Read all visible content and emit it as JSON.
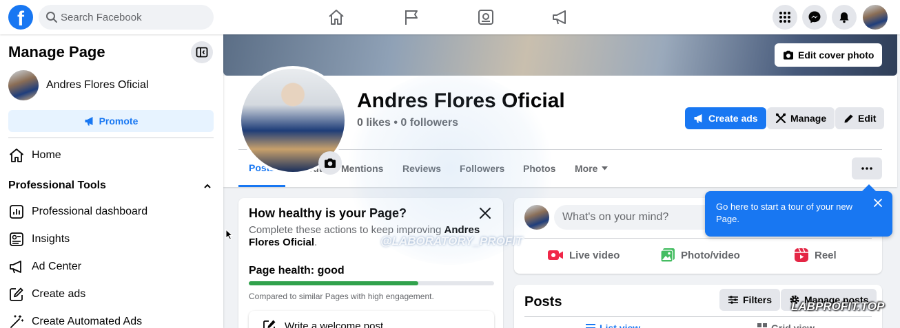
{
  "topbar": {
    "logo": "f",
    "search_placeholder": "Search Facebook",
    "nav_icons": [
      "home-icon",
      "flag-icon",
      "dashboard-icon",
      "megaphone-icon"
    ],
    "right_icons": [
      "apps-grid-icon",
      "messenger-icon",
      "bell-icon"
    ]
  },
  "sidebar": {
    "title": "Manage Page",
    "page_name": "Andres Flores Oficial",
    "promote_label": "Promote",
    "home_label": "Home",
    "section_title": "Professional Tools",
    "tools": [
      {
        "label": "Professional dashboard",
        "icon": "dashboard-icon"
      },
      {
        "label": "Insights",
        "icon": "insights-icon"
      },
      {
        "label": "Ad Center",
        "icon": "megaphone-icon"
      },
      {
        "label": "Create ads",
        "icon": "pencil-square-icon"
      },
      {
        "label": "Create Automated Ads",
        "icon": "magic-wand-icon"
      }
    ]
  },
  "cover": {
    "edit_label": "Edit cover photo"
  },
  "profile": {
    "name": "Andres Flores Oficial",
    "stats": "0 likes • 0 followers",
    "create_ads_label": "Create ads",
    "manage_label": "Manage",
    "edit_label": "Edit"
  },
  "tabs": [
    {
      "label": "Posts",
      "active": true
    },
    {
      "label": "About",
      "active": false
    },
    {
      "label": "Mentions",
      "active": false
    },
    {
      "label": "Reviews",
      "active": false
    },
    {
      "label": "Followers",
      "active": false
    },
    {
      "label": "Photos",
      "active": false
    },
    {
      "label": "More",
      "active": false
    }
  ],
  "health": {
    "title": "How healthy is your Page?",
    "desc_prefix": "Complete these actions to keep improving ",
    "desc_name": "Andres Flores Oficial",
    "desc_suffix": ".",
    "status_label": "Page health: good",
    "progress": 0.69,
    "note": "Compared to similar Pages with high engagement.",
    "task_label": "Write a welcome post"
  },
  "composer": {
    "placeholder": "What's on your mind?",
    "actions": [
      {
        "label": "Live video",
        "icon": "live-video-icon",
        "color": "#f02849"
      },
      {
        "label": "Photo/video",
        "icon": "photo-icon",
        "color": "#45bd62"
      },
      {
        "label": "Reel",
        "icon": "reel-icon",
        "color": "#e42645"
      }
    ]
  },
  "posts": {
    "title": "Posts",
    "filters_label": "Filters",
    "manage_label": "Manage posts",
    "list_view_label": "List view",
    "grid_view_label": "Grid view"
  },
  "tour": {
    "text": "Go here to start a tour of your new Page."
  },
  "overlay": {
    "watermark": "@LABORATORY_PROFIT",
    "corner_mark": "LABPROFIT.TOP"
  },
  "colors": {
    "brand": "#1877f2",
    "health_good": "#31a24c",
    "background": "#f0f2f5"
  }
}
